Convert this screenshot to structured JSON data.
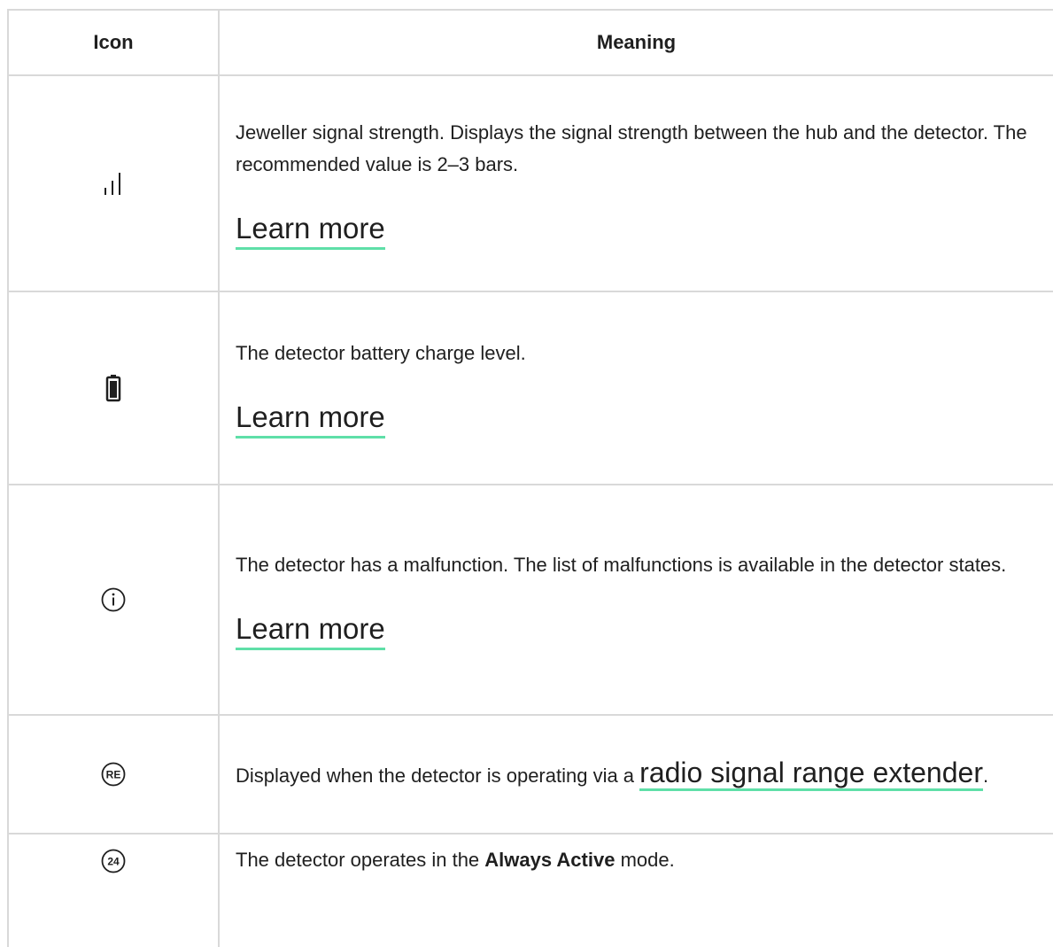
{
  "table": {
    "header": {
      "icon": "Icon",
      "meaning": "Meaning"
    },
    "rows": [
      {
        "icon": "signal-strength-icon",
        "text": "Jeweller signal strength. Displays the signal strength between the hub and the detector. The recommended value is 2–3 bars.",
        "link": "Learn more"
      },
      {
        "icon": "battery-icon",
        "text": "The detector battery charge level.",
        "link": "Learn more"
      },
      {
        "icon": "info-icon",
        "text": "The detector has a malfunction. The list of malfunctions is available in the detector states.",
        "link": "Learn more"
      },
      {
        "icon": "range-extender-icon",
        "icon_label": "RE",
        "text_before": "Displayed when the detector is operating via a ",
        "link": "radio signal range extender",
        "text_after": "."
      },
      {
        "icon": "always-active-icon",
        "icon_label": "24",
        "text_before": "The detector operates in the ",
        "bold": "Always Active",
        "text_after": " mode."
      }
    ]
  },
  "colors": {
    "border": "#d9d9d9",
    "link_underline": "#5fdfa8",
    "text": "#1f1f1f"
  }
}
